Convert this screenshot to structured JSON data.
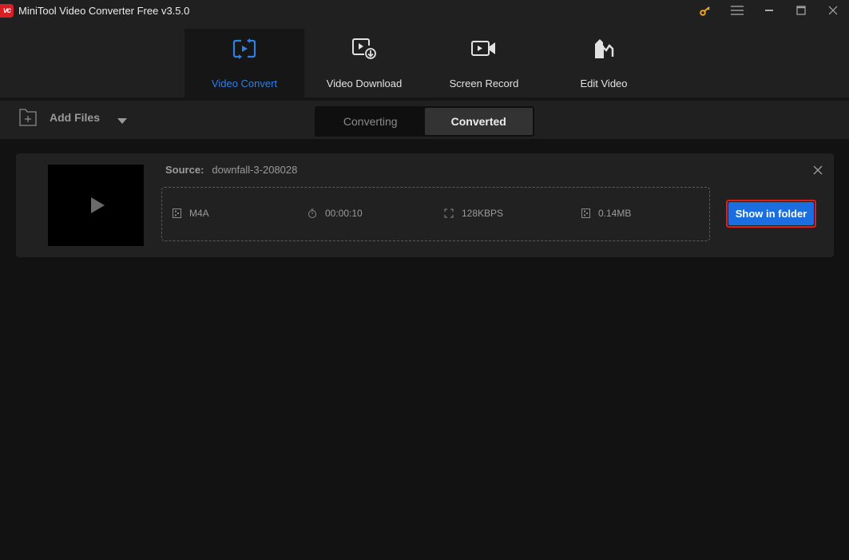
{
  "window": {
    "logo_text": "vc",
    "title": "MiniTool Video Converter Free v3.5.0",
    "controls": [
      "key-icon",
      "menu-icon",
      "minimize-icon",
      "maximize-icon",
      "close-icon"
    ]
  },
  "nav": {
    "items": [
      {
        "label": "Video Convert",
        "icon": "video-convert-icon",
        "active": true
      },
      {
        "label": "Video Download",
        "icon": "video-download-icon",
        "active": false
      },
      {
        "label": "Screen Record",
        "icon": "screen-record-icon",
        "active": false
      },
      {
        "label": "Edit Video",
        "icon": "edit-video-icon",
        "active": false
      }
    ]
  },
  "toolbar": {
    "add_files_label": "Add Files",
    "tabs": [
      {
        "label": "Converting",
        "active": false
      },
      {
        "label": "Converted",
        "active": true
      }
    ]
  },
  "converted_item": {
    "source_label": "Source:",
    "source_value": "downfall-3-208028",
    "format": "M4A",
    "duration": "00:00:10",
    "bitrate": "128KBPS",
    "size": "0.14MB",
    "show_in_folder_label": "Show in folder"
  },
  "colors": {
    "accent": "#2f7fe5",
    "button_blue": "#1a6ee0",
    "highlight_red": "#e21b1b",
    "logo_red": "#d81f26",
    "key_gold": "#f0a818"
  }
}
